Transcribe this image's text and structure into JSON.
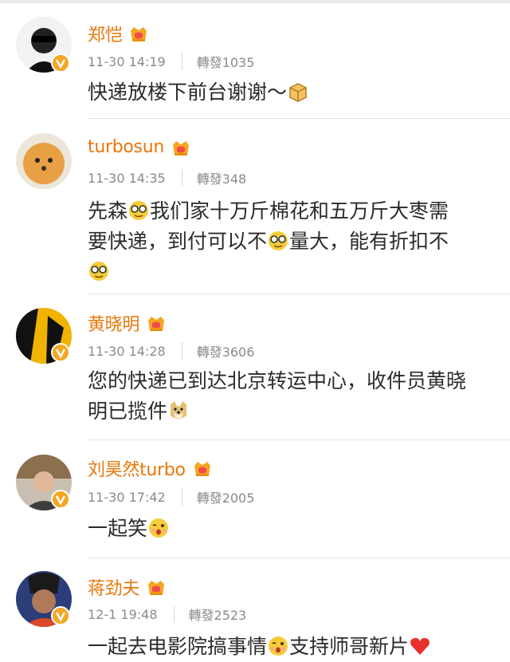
{
  "comments": [
    {
      "username": "郑恺",
      "time": "11-30 14:19",
      "repost": "轉發1035",
      "text_parts": [
        "快递放楼下前台谢谢～"
      ],
      "emojis": [
        "box-emoji"
      ]
    },
    {
      "username": "turbosun",
      "time": "11-30 14:35",
      "repost": "轉發348",
      "text_parts": [
        "先森",
        "我们家十万斤棉花和五万斤大枣需",
        "要快递，到付可以不",
        "量大，能有折扣不"
      ],
      "emojis": [
        "nerd-emoji",
        "nerd-emoji",
        "nerd-emoji"
      ]
    },
    {
      "username": "黄晓明",
      "time": "11-30 14:28",
      "repost": "轉發3606",
      "text_parts": [
        "您的快递已到达北京转运中心，收件员黄晓",
        "明已揽件"
      ],
      "emojis": [
        "doge-emoji"
      ]
    },
    {
      "username": "刘昊然turbo",
      "time": "11-30 17:42",
      "repost": "轉發2005",
      "text_parts": [
        "一起笑"
      ],
      "emojis": [
        "wink-emoji"
      ]
    },
    {
      "username": "蒋劲夫",
      "time": "12-1 19:48",
      "repost": "轉發2523",
      "text_parts": [
        "一起去电影院搞事情",
        "支持师哥新片"
      ],
      "emojis": [
        "wink-emoji",
        "heart-emoji"
      ]
    }
  ],
  "colors": {
    "username": "#e8770a",
    "meta": "#8a8a8a",
    "badge": "#f5a623"
  }
}
